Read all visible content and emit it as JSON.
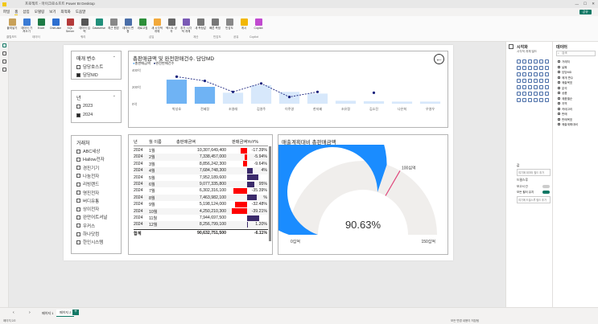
{
  "window": {
    "title": "프로젝트 - 마이크로소프트 Power BI Desktop",
    "minimize": "—",
    "maximize": "☐",
    "close": "✕"
  },
  "menu": {
    "items": [
      "파일",
      "홈",
      "삽입",
      "모델링",
      "보기",
      "최적화",
      "도움말"
    ],
    "share_label": "공유"
  },
  "ribbon": {
    "buttons": [
      {
        "label": "붙여넣기",
        "color": "#c8a15a"
      },
      {
        "label": "데이터 가져오기",
        "color": "#3a7bd5"
      },
      {
        "label": "Excel",
        "color": "#1d7a45"
      },
      {
        "label": "OneLake",
        "color": "#2d6fd0"
      },
      {
        "label": "SQL Server",
        "color": "#b33a3a"
      },
      {
        "label": "데이터 입력",
        "color": "#555"
      },
      {
        "label": "Dataverse",
        "color": "#1f8f7a"
      },
      {
        "label": "최근 원본",
        "color": "#888"
      },
      {
        "label": "데이터 변환",
        "color": "#4a6ea8"
      },
      {
        "label": "새로고침",
        "color": "#2d8f3a"
      },
      {
        "label": "새 시각적 개체",
        "color": "#f2a93b"
      },
      {
        "label": "텍스트 상자",
        "color": "#666"
      },
      {
        "label": "추가 시각적 개체",
        "color": "#7a5ab5"
      },
      {
        "label": "새 측정값",
        "color": "#777"
      },
      {
        "label": "빠른 측정",
        "color": "#777"
      },
      {
        "label": "민감도",
        "color": "#888"
      },
      {
        "label": "게시",
        "color": "#f2b705"
      },
      {
        "label": "Copilot",
        "color": "#c14ad0"
      }
    ],
    "groups": [
      "클립보드",
      "데이터",
      "쿼리",
      "삽입",
      "계산",
      "민감도",
      "공유",
      "Copilot"
    ]
  },
  "slicers": {
    "metric_type": {
      "title": "매개 변수",
      "items": [
        {
          "label": "담당호스트",
          "checked": false
        },
        {
          "label": "담당MD",
          "checked": true
        }
      ]
    },
    "year": {
      "title": "년",
      "items": [
        {
          "label": "2023",
          "checked": false
        },
        {
          "label": "2024",
          "checked": true
        }
      ]
    },
    "vendor": {
      "title": "거래처",
      "items": [
        {
          "label": "ABC세상",
          "checked": false
        },
        {
          "label": "Hallow전자",
          "checked": false
        },
        {
          "label": "경진기기",
          "checked": false
        },
        {
          "label": "나눔전자",
          "checked": false
        },
        {
          "label": "리빙랜드",
          "checked": false
        },
        {
          "label": "명진전자",
          "checked": false
        },
        {
          "label": "버디유통",
          "checked": false
        },
        {
          "label": "상이전자",
          "checked": false
        },
        {
          "label": "완만어트셔널",
          "checked": false
        },
        {
          "label": "우커스",
          "checked": false
        },
        {
          "label": "하나닷컴",
          "checked": false
        },
        {
          "label": "한인시스템",
          "checked": false
        }
      ]
    }
  },
  "combo_chart": {
    "title": "총판매금액 및 완전판매건수. 담당MD",
    "legend": [
      "총판매금액",
      "완전판매건수"
    ],
    "back_icon": "back-arrow-icon"
  },
  "table": {
    "headers": [
      "년",
      "월 이름",
      "총판매금액",
      "판매금액YoY%"
    ],
    "rows": [
      {
        "year": "2024",
        "month": "1월",
        "amount": "10,307,649,400",
        "yoy": "-17.39%",
        "yoy_value": -17.39
      },
      {
        "year": "2024",
        "month": "2월",
        "amount": "7,338,457,000",
        "yoy": "-5.94%",
        "yoy_value": -5.94
      },
      {
        "year": "2024",
        "month": "3월",
        "amount": "8,856,242,300",
        "yoy": "-9.64%",
        "yoy_value": -9.64
      },
      {
        "year": "2024",
        "month": "4월",
        "amount": "7,684,748,300",
        "yoy": "4%",
        "yoy_value": 14
      },
      {
        "year": "2024",
        "month": "5월",
        "amount": "7,952,189,600",
        "yoy": "",
        "yoy_value": 30
      },
      {
        "year": "2024",
        "month": "6월",
        "amount": "9,077,335,800",
        "yoy": "95%",
        "yoy_value": 19.95
      },
      {
        "year": "2024",
        "month": "7월",
        "amount": "6,302,316,100",
        "yoy": "-35.39%",
        "yoy_value": -35.39
      },
      {
        "year": "2024",
        "month": "8월",
        "amount": "7,463,982,100",
        "yoy": "%",
        "yoy_value": 26
      },
      {
        "year": "2024",
        "month": "9월",
        "amount": "5,198,124,000",
        "yoy": "-32.48%",
        "yoy_value": -32.48
      },
      {
        "year": "2024",
        "month": "10월",
        "amount": "4,250,210,300",
        "yoy": "-39.21%",
        "yoy_value": -39.21
      },
      {
        "year": "2024",
        "month": "11월",
        "amount": "7,944,697,500",
        "yoy": "",
        "yoy_value": 32
      },
      {
        "year": "2024",
        "month": "12월",
        "amount": "8,256,799,100",
        "yoy": "1.20%",
        "yoy_value": 1.2
      }
    ],
    "total": {
      "label": "합계",
      "amount": "90,632,751,500",
      "yoy": "-6.11%"
    }
  },
  "gauge": {
    "title": "매출계획대비 총판매금액",
    "value_label": "90.63%",
    "value": 90.63,
    "min_label": "0십억",
    "max_label": "150십억",
    "target_label": "100십억",
    "min": 0,
    "max": 150,
    "actual": 90.63,
    "target": 100,
    "fill_color": "#1a8cff",
    "track_color": "#f0eeec",
    "target_color": "#e0457b"
  },
  "chart_data": {
    "type": "bar",
    "title": "총판매금액 및 완전판매건수. 담당MD",
    "ylim_text": [
      "400억",
      "200억",
      "0억"
    ],
    "ylim": [
      0,
      40
    ],
    "categories": [
      "박성호",
      "전혜정",
      "조영래",
      "김영주",
      "이주영",
      "한지혜",
      "조유정",
      "김소진",
      "나은희",
      "우영우"
    ],
    "series": [
      {
        "name": "총판매금액",
        "type": "bar",
        "values": [
          28.5,
          20,
          13,
          22,
          14,
          12,
          3.5,
          3,
          2.5,
          2.5
        ]
      },
      {
        "name": "완전판매건수",
        "type": "line",
        "values": [
          32,
          27,
          14,
          24,
          8,
          14,
          null,
          13,
          null,
          null
        ]
      }
    ],
    "xlabel": "",
    "ylabel": ""
  },
  "pages": {
    "tabs": [
      "페이지 1",
      "페이지 2"
    ],
    "add_label": "+"
  },
  "status": {
    "left": "페이지 2/2",
    "right": "모든 변경 내용이 저장됨"
  },
  "panels": {
    "viz": {
      "title": "시각화",
      "subtitle": "시각적 개체 빌드",
      "section_label": "값",
      "field_hint": "여기에 데이터 필드 추가",
      "drill_title": "드릴스루",
      "cross_report": "보고서 간",
      "keep_filters": "모든 필터 유지",
      "drill_hint": "여기에 드릴스루 필드 추가"
    },
    "data": {
      "title": "데이터",
      "search_placeholder": "검색",
      "tables": [
        "거래처",
        "날짜",
        "담당MD",
        "매개 변수",
        "매출목표",
        "분석",
        "상품",
        "제품별순",
        "지역",
        "카테고리",
        "판매",
        "판매목표",
        "매출계획대비"
      ]
    }
  }
}
